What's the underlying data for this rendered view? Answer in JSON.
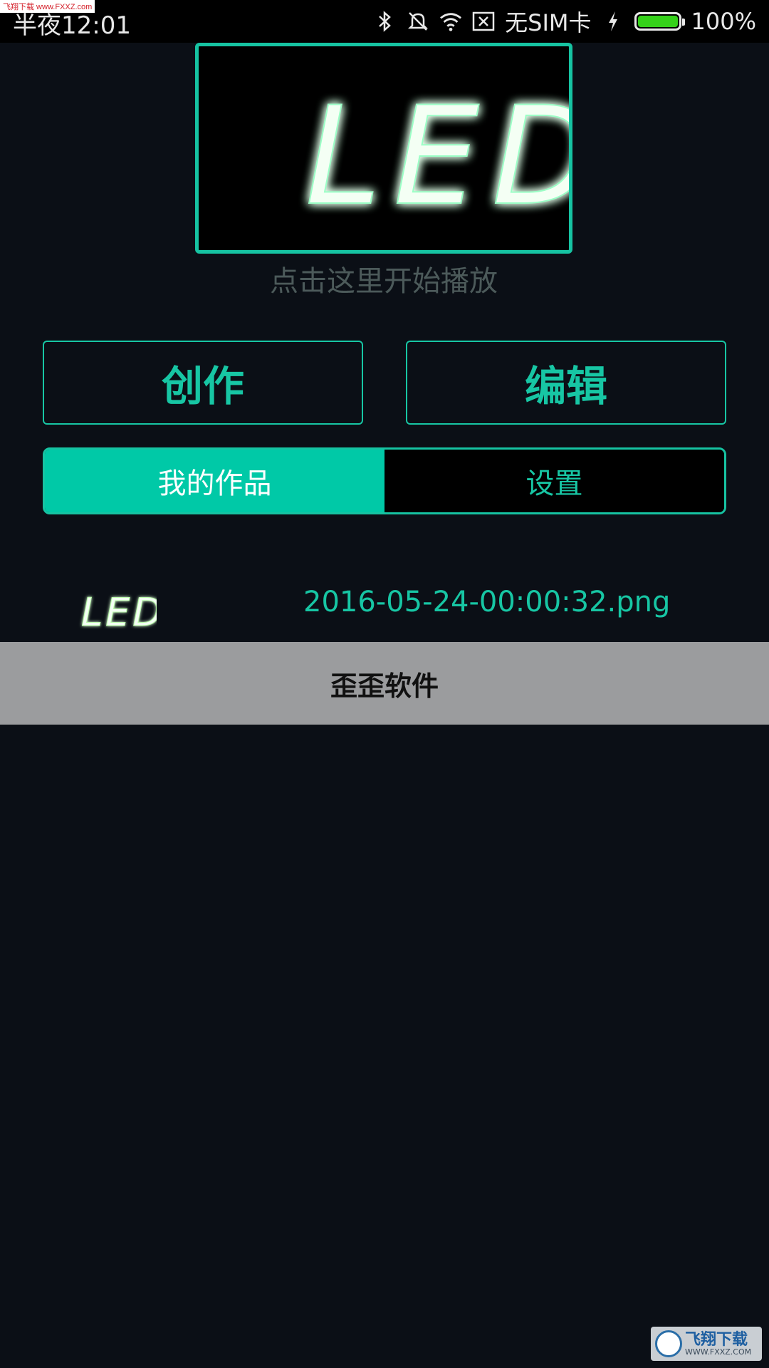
{
  "status_bar": {
    "time": "半夜12:01",
    "sim": "无SIM卡",
    "battery_percent": "100%",
    "battery_level": 1.0,
    "icons": [
      "bluetooth-icon",
      "mute-icon",
      "wifi-icon",
      "no-sim-icon",
      "charging-icon",
      "battery-icon"
    ]
  },
  "watermarks": {
    "top_left": "飞翔下载 www.FXXZ.com",
    "bottom_right_title": "飞翔下载",
    "bottom_right_url": "WWW.FXXZ.COM"
  },
  "preview": {
    "led_text": "LED",
    "hint": "点击这里开始播放"
  },
  "actions": {
    "create_label": "创作",
    "edit_label": "编辑"
  },
  "tabs": [
    {
      "label": "我的作品",
      "active": true
    },
    {
      "label": "设置",
      "active": false
    }
  ],
  "works": [
    {
      "thumb_text": "LED",
      "filename": "2016-05-24-00:00:32.png"
    }
  ],
  "footer": {
    "label": "歪歪软件"
  },
  "colors": {
    "accent": "#00c9a7",
    "background": "#0b0f16",
    "footer_bar": "#9b9c9e"
  }
}
